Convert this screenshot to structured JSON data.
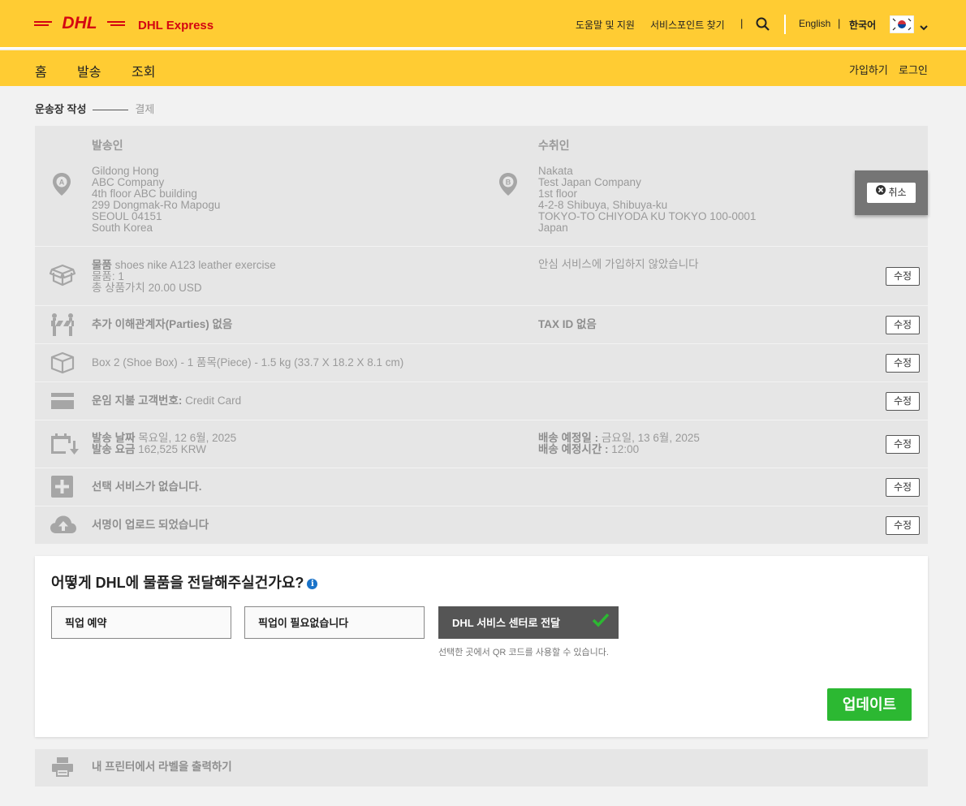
{
  "header": {
    "brand": "DHL Express",
    "help": "도움말 및 지원",
    "find_location": "서비스포인트 찾기",
    "lang_english": "English",
    "lang_korean": "한국어"
  },
  "nav": {
    "home": "홈",
    "ship": "발송",
    "track": "조회",
    "signup": "가입하기",
    "login": "로그인"
  },
  "steps": {
    "step1": "운송장 작성",
    "step2": "결제"
  },
  "sender": {
    "title": "발송인",
    "name": "Gildong Hong",
    "company": "ABC Company",
    "addr1": "4th floor ABC building",
    "addr2": "299 Dongmak-Ro Mapogu",
    "city": "SEOUL 04151",
    "country": "South Korea"
  },
  "receiver": {
    "title": "수취인",
    "name": "Nakata",
    "company": "Test Japan Company",
    "addr1": "1st floor",
    "addr2": "4-2-8 Shibuya, Shibuya-ku",
    "city": "TOKYO-TO CHIYODA KU TOKYO 100-0001",
    "country": "Japan"
  },
  "cancel_label": "취소",
  "edit_label": "수정",
  "goods": {
    "label": "물품",
    "desc": "shoes nike A123 leather exercise",
    "qty": "물품: 1",
    "value": "총 상품가치 20.00 USD",
    "insurance": "안심 서비스에 가입하지 않았습니다"
  },
  "parties": {
    "text": "추가 이해관계자(Parties) 없음",
    "tax": "TAX ID 없음"
  },
  "package": {
    "text": "Box 2 (Shoe Box) - 1 품목(Piece) - 1.5 kg (33.7 X 18.2 X 8.1 cm)"
  },
  "payment": {
    "label": "운임 지불 고객번호:",
    "value": "Credit Card"
  },
  "dates": {
    "ship_label": "발송 날짜",
    "ship_value": "목요일, 12 6월, 2025",
    "cost_label": "발송 요금",
    "cost_value": "162,525 KRW",
    "est_label": "배송 예정일 :",
    "est_value": "금요일, 13 6월, 2025",
    "time_label": "배송 예정시간 :",
    "time_value": "12:00"
  },
  "services": {
    "text": "선택 서비스가 없습니다."
  },
  "signature": {
    "text": "서명이 업로드 되었습니다"
  },
  "delivery": {
    "question": "어떻게 DHL에 물품을 전달해주실건가요?",
    "opt1": "픽업 예약",
    "opt2": "픽업이 필요없습니다",
    "opt3": "DHL 서비스 센터로 전달",
    "hint": "선택한 곳에서 QR 코드를 사용할 수 있습니다.",
    "update": "업데이트"
  },
  "print": {
    "text": "내 프린터에서 라벨을 출력하기"
  }
}
